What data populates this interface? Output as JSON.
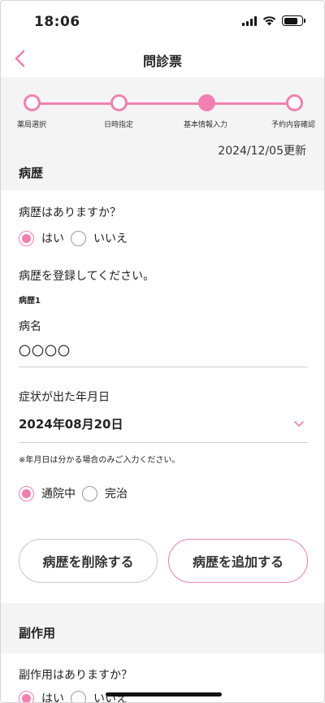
{
  "status_bar": {
    "time": "18:06"
  },
  "nav": {
    "title": "問診票",
    "back_icon": "chevron-left-icon"
  },
  "stepper": {
    "steps": [
      "薬局選択",
      "日時指定",
      "基本情報入力",
      "予約内容確認"
    ],
    "current_step_index": 2
  },
  "updated_date": "2024/12/05更新",
  "medical_history": {
    "section_title": "病歴",
    "question": "病歴はありますか？",
    "options": [
      "はい",
      "いいえ"
    ],
    "selected_option": "はい",
    "register_prompt": "病歴を登録してください。",
    "entry_title": "病歴1",
    "disease_label": "病名",
    "disease_value": "〇〇〇〇",
    "onset_label": "症状が出た年月日",
    "onset_value": "2024年08月20日",
    "onset_note": "※年月日は分かる場合のみご入力ください。",
    "status_options": [
      "通院中",
      "完治"
    ],
    "selected_status": "通院中",
    "delete_button": "病歴を削除する",
    "add_button": "病歴を追加する"
  },
  "side_effects": {
    "section_title": "副作用",
    "question": "副作用はありますか？",
    "options": [
      "はい",
      "いいえ"
    ],
    "selected_option": "はい"
  },
  "colors": {
    "accent": "#f080b0",
    "section_bg": "#f4f4f4"
  }
}
